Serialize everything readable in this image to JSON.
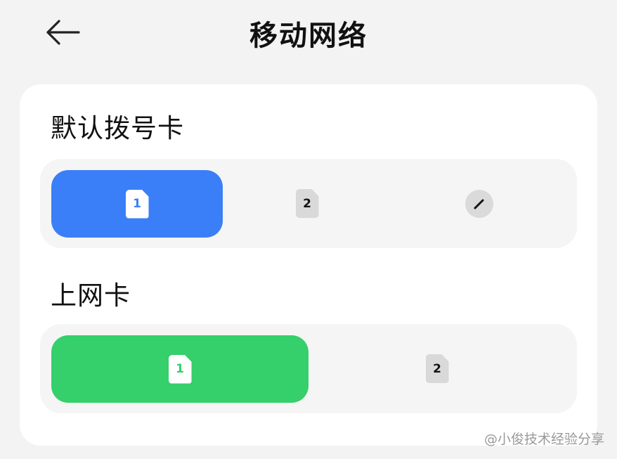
{
  "header": {
    "title": "移动网络"
  },
  "default_dial_card": {
    "label": "默认拨号卡",
    "options": [
      {
        "sim_number": "1",
        "selected": true
      },
      {
        "sim_number": "2",
        "selected": false
      },
      {
        "icon": "pen-icon",
        "selected": false
      }
    ]
  },
  "data_card": {
    "label": "上网卡",
    "options": [
      {
        "sim_number": "1",
        "selected": true
      },
      {
        "sim_number": "2",
        "selected": false
      }
    ]
  },
  "watermark": {
    "text": "@小俊技术经验分享"
  },
  "colors": {
    "dial_selected": "#3a7ff7",
    "data_selected": "#35cf6b",
    "background": "#f3f3f3",
    "card": "#ffffff",
    "segment_track": "#f5f5f5"
  }
}
